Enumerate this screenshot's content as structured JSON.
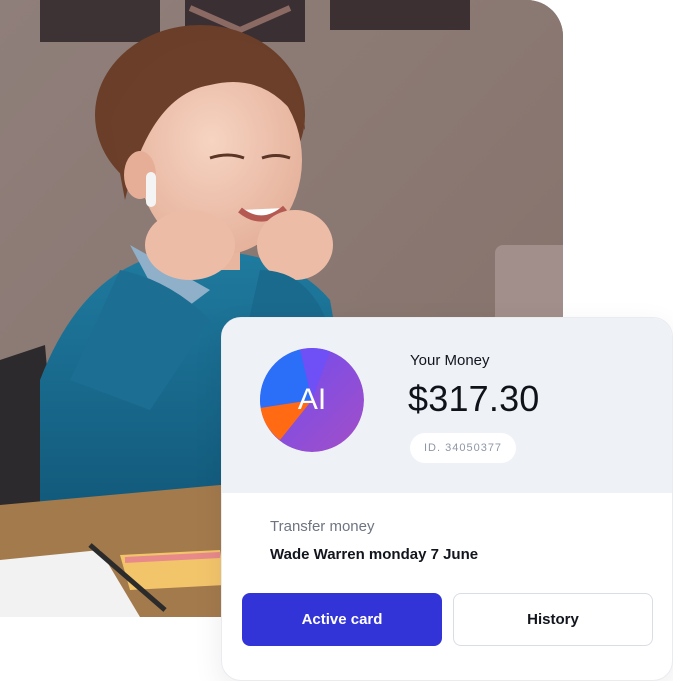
{
  "wallet": {
    "avatar_initials": "AI",
    "balance_label": "Your Money",
    "balance_amount": "$317.30",
    "card_id": "ID. 34050377"
  },
  "transfer": {
    "label": "Transfer money",
    "detail": "Wade Warren monday 7 June"
  },
  "actions": {
    "primary_label": "Active card",
    "secondary_label": "History"
  },
  "colors": {
    "primary": "#3334d8",
    "panel_background": "#eef1f6",
    "avatar_gradient": [
      "#6a4cf5",
      "#a44fc6"
    ],
    "avatar_accent_blue": "#2b6ef8",
    "avatar_accent_orange": "#ff6a13"
  },
  "icons": {
    "photo": "child-with-earbuds-photo"
  }
}
